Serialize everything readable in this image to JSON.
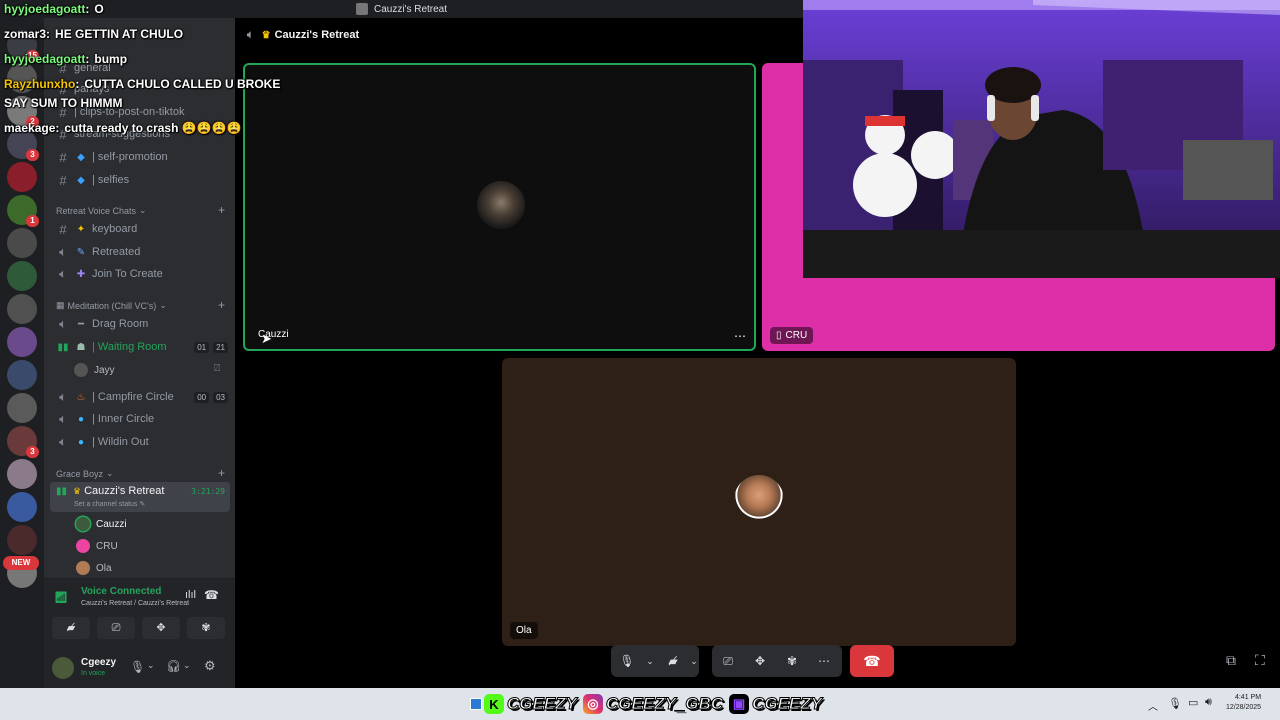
{
  "window": {
    "title": "Cauzzi's Retreat"
  },
  "chat_overlay": [
    {
      "user": "hyyjoedagoatt",
      "sep": ":",
      "text": "O"
    },
    {
      "user": "zomar3",
      "sep": ":",
      "text": "HE GETTIN AT CHULO"
    },
    {
      "user": "hyyjoedagoatt",
      "sep": ":",
      "text": "bump"
    },
    {
      "user": "Rayzhunxho",
      "sep": ":",
      "text": "CUTTA CHULO CALLED U BROKE"
    },
    {
      "user": "",
      "sep": "",
      "text": "SAY SUM TO HIMMM"
    },
    {
      "user": "maekage",
      "sep": ":",
      "text": "cutta ready to crash 😩😩😩😩"
    }
  ],
  "servers": [
    {
      "badge": "15"
    },
    {
      "badge": ""
    },
    {
      "badge": "2"
    },
    {
      "badge": "3"
    },
    {
      "badge": ""
    },
    {
      "badge": "1"
    },
    {
      "badge": ""
    },
    {
      "badge": ""
    },
    {
      "badge": ""
    },
    {
      "badge": ""
    },
    {
      "badge": ""
    },
    {
      "badge": ""
    },
    {
      "badge": "3"
    },
    {
      "badge": ""
    },
    {
      "badge": ""
    },
    {
      "badge": ""
    },
    {
      "badge": ""
    }
  ],
  "new_badge": "NEW",
  "sidebar": {
    "partial_channels": [
      "general",
      "parlays",
      "| clips-to-post-on-tiktok",
      "stream-suggestions"
    ],
    "text_channels": [
      {
        "label": "| self-promotion",
        "icon": "💎"
      },
      {
        "label": "| selfies",
        "icon": "💎"
      }
    ],
    "categories": {
      "retreat": "Retreat Voice Chats",
      "meditation": "Meditation (Chill VC's)",
      "grace": "Grace Boyz"
    },
    "retreat_channels": [
      {
        "label": "keyboard",
        "icon": "✨",
        "type": "text"
      },
      {
        "label": "Retreated",
        "icon": "✍",
        "type": "voice"
      },
      {
        "label": "Join To Create",
        "icon": "➕",
        "type": "voice"
      }
    ],
    "meditation_channels": [
      {
        "label": "Drag Room",
        "icon": "➖"
      },
      {
        "label": "| Waiting Room",
        "icon": "👥",
        "count_a": "01",
        "count_b": "21"
      },
      {
        "label": "| Campfire Circle",
        "icon": "🔥",
        "count_a": "00",
        "count_b": "03"
      },
      {
        "label": "| Inner Circle",
        "icon": "💧"
      },
      {
        "label": "| Wildin Out",
        "icon": "💧"
      }
    ],
    "waiting_member": "Jayy",
    "active_channel": {
      "label": "Cauzzi's Retreat",
      "time": "3:21:29",
      "status": "Set a channel status"
    },
    "members": [
      "Cauzzi",
      "CRU",
      "Ola"
    ]
  },
  "voice": {
    "status": "Voice Connected",
    "location": "Cauzzi's Retreat / Cauzzi's Retreat"
  },
  "user": {
    "name": "Cgeezy",
    "status": "In voice"
  },
  "tiles": {
    "cauzzi": "Cauzzi",
    "cru": "CRU",
    "ola": "Ola"
  },
  "colors": {
    "accent_green": "#23a55a",
    "cru_bg": "#dd2fa8",
    "ola_bg": "#2e1f17",
    "hangup": "#da373c"
  },
  "socials": [
    {
      "icon": "kick-icon",
      "handle": "CGEEZY"
    },
    {
      "icon": "instagram-icon",
      "handle": "CGEEZY_GBC"
    },
    {
      "icon": "twitch-icon",
      "handle": "CGEEZY"
    }
  ],
  "clock": {
    "time": "4:41 PM",
    "date": "12/28/2025"
  }
}
